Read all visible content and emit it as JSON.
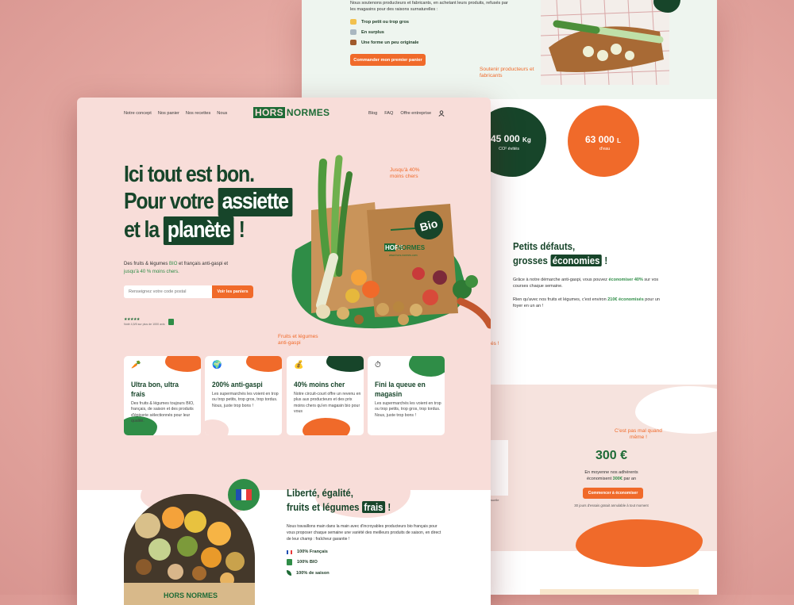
{
  "back": {
    "intro": "Nous soutenons producteurs et fabricants, en achetant leurs produits, refusés par les magasins pour des raisons surnaturelles :",
    "reasons": [
      "Trop petit ou trop gros",
      "En surplus",
      "Une forme un peu originale"
    ],
    "cta_first_basket": "Commander mon premier panier",
    "support_annotation": "Soutenir producteurs et fabricants",
    "stats": [
      {
        "value": "45 000",
        "unit": "Kg",
        "label": "CO² évités"
      },
      {
        "value": "63 000",
        "unit": "L",
        "label": "d'eau"
      }
    ],
    "defects_title_1": "Petits défauts,",
    "defects_title_2": "grosses",
    "defects_highlight": "économies",
    "defects_title_end": "!",
    "defects_p1a": "Grâce à notre démarche anti-gaspi, vous pouvez",
    "defects_p1_hl": "économiser 40%",
    "defects_p1b": "sur vos courses chaque semaine.",
    "defects_p2a": "Rien qu'avec nos fruits et légumes, c'est environ",
    "defects_p2_hl": "210€ économisés",
    "defects_p2b": "pour un foyer en un an !",
    "exclaim": "és !",
    "not_bad_annotation": "C'est pas mal quand même !",
    "savings_value": "300 €",
    "savings_line1": "En moyenne nos adhérents",
    "savings_line2a": "économisent",
    "savings_line2_hl": "300€",
    "savings_line2b": "par an",
    "cta_start_saving": "Commencer à économiser",
    "trial_note": "30 jours d'essais gratuit annulable à tout moment",
    "stray_label": "suelle"
  },
  "front": {
    "nav_left": [
      "Notre concept",
      "Nos panier",
      "Nos recettes",
      "Nous"
    ],
    "logo_a": "HORS",
    "logo_b": "NORMES",
    "nav_right": [
      "Blog",
      "FAQ",
      "Offre entreprise"
    ],
    "user_icon": "user-icon",
    "hero_line1": "Ici tout est bon.",
    "hero_line2a": "Pour votre",
    "hero_line2_hl": "assiette",
    "hero_line3a": "et la",
    "hero_line3_hl": "planète",
    "hero_line3b": "!",
    "hero_sub_a": "Des fruits & légumes",
    "hero_sub_bio": "BIO",
    "hero_sub_b": "et français anti-gaspi",
    "hero_sub_c": "et",
    "hero_sub_hl": "jusqu'à 40 % moins chers.",
    "postal_placeholder": "Renseignez votre code postal",
    "see_baskets": "Voir les paniers",
    "rating_stars": "★★★★★",
    "rating_text": "Noté 4,5/5 sur plus de 1000 avis",
    "annot_price": "Jusqu'à 40% moins chers",
    "annot_fruits": "Fruits et légumes anti-gaspi",
    "bio_badge": "Bio",
    "bag_logo_a": "HORS",
    "bag_logo_b": "NORMES",
    "bag_url": "www.hors-normes.com",
    "cards": [
      {
        "icon": "carrot-icon",
        "glyph": "🥕",
        "title": "Ultra bon, ultra frais",
        "text": "Des fruits & légumes toujours BIO, français, de saison et des produits d'épicerie sélectionnés pour leur qualité.",
        "accent": "#f06a2a"
      },
      {
        "icon": "earth-icon",
        "glyph": "🌍",
        "title": "200% anti-gaspi",
        "text": "Les supermarchés les voient en trop ou trop petits, trop gros, trop tordus. Nous, juste trop bons !",
        "accent": "#f06a2a"
      },
      {
        "icon": "money-bag-icon",
        "glyph": "💰",
        "title": "40% moins cher",
        "text": "Notre circuit-court offre un revenu en plus aux producteurs et des prix moins chers qu'en magasin bio pour vous",
        "accent": "#f06a2a"
      },
      {
        "icon": "stopwatch-icon",
        "glyph": "⏱",
        "title": "Fini la queue en magasin",
        "text": "Les supermarchés les voient en trop ou trop petits, trop gros, trop tordus. Nous, juste trop bons !",
        "accent": "#2f8d47"
      }
    ],
    "lib_title_1": "Liberté, égalité,",
    "lib_title_2": "fruits et légumes",
    "lib_highlight": "frais",
    "lib_title_end": "!",
    "lib_text": "Nous travaillons main dans la main avec d'incroyables producteurs bio français pour vous proposer chaque semaine une variété des meilleurs produits de saison, en direct de leur champ : fraîcheur garantie !",
    "lib_list": [
      {
        "icon": "france-flag-icon",
        "label": "100% Français"
      },
      {
        "icon": "ab-bio-icon",
        "label": "100% BIO"
      },
      {
        "icon": "leaf-icon",
        "label": "100% de saison"
      }
    ],
    "crate_label": "HORS NORMES"
  },
  "colors": {
    "primary_green": "#17452a",
    "brand_green": "#1e6b36",
    "accent_orange": "#f06a2a",
    "hero_pink": "#f8ddd9"
  }
}
